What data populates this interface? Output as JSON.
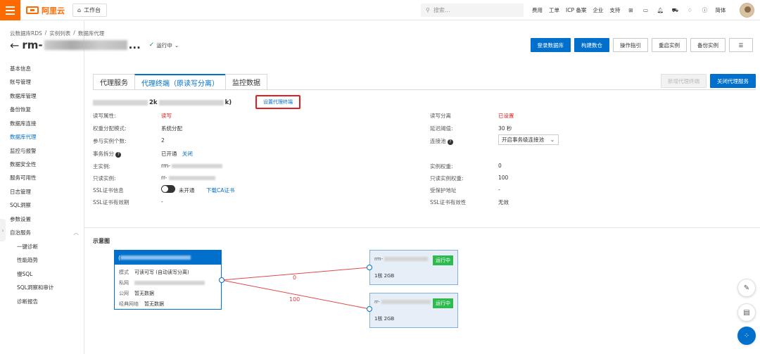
{
  "topbar": {
    "logo_text": "阿里云",
    "workbench": "工作台",
    "search_placeholder": "搜索...",
    "links": [
      "费用",
      "工单",
      "ICP 备案",
      "企业",
      "支持"
    ],
    "lang": "简体"
  },
  "sidebar": {
    "items": [
      "基本信息",
      "账号管理",
      "数据库管理",
      "备份恢复",
      "数据库连接",
      "数据库代理",
      "监控与报警",
      "数据安全性",
      "服务可用性",
      "日志管理",
      "SQL洞察",
      "参数设置",
      "自治服务"
    ],
    "active_index": 5,
    "sub_items": [
      "一键诊断",
      "性能趋势",
      "慢SQL",
      "SQL洞察和审计",
      "诊断报告"
    ]
  },
  "header": {
    "breadcrumb": [
      "云数据库RDS",
      "/",
      "实例列表",
      "/",
      "数据库代理"
    ],
    "title_prefix": "rm-",
    "title_suffix": "...",
    "status": "运行中",
    "buttons": [
      "登录数据库",
      "构建数仓",
      "操作指引",
      "重启实例",
      "备份实例"
    ]
  },
  "tabs": {
    "items": [
      "代理服务",
      "代理终端（原读写分离）",
      "监控数据"
    ],
    "active_index": 1,
    "new_endpoint": "新增代理终端",
    "close_proxy": "关闭代理服务"
  },
  "endpoint": {
    "name_fragment_1": "2k",
    "name_fragment_2": "k)",
    "set_endpoint": "设置代理终端"
  },
  "left_info": [
    {
      "label": "读写属性:",
      "value": "读写"
    },
    {
      "label": "权重分配模式:",
      "value": "系统分配"
    },
    {
      "label": "参与实例个数:",
      "value": "2"
    },
    {
      "label": "事务拆分",
      "value": "已开通",
      "link": "关闭"
    },
    {
      "label": "主实例:",
      "value": "rm-"
    },
    {
      "label": "只读实例:",
      "value": "rr-"
    },
    {
      "label": "SSL证书信息",
      "value": "未开通",
      "link": "下载CA证书"
    },
    {
      "label": "SSL证书有效期",
      "value": "-"
    }
  ],
  "right_info": [
    {
      "label": "读写分离",
      "value": "已设置"
    },
    {
      "label": "延迟阈值:",
      "value": "30 秒"
    },
    {
      "label": "连接池",
      "value": "开启事务级连接池"
    },
    {
      "label": "实例权重:",
      "value": "0"
    },
    {
      "label": "只读实例权重:",
      "value": "100"
    },
    {
      "label": "受保护地址",
      "value": "-"
    },
    {
      "label": "SSL证书有效性",
      "value": "无效"
    }
  ],
  "diagram": {
    "title": "示意图",
    "proxy": {
      "head": "(",
      "rows": [
        {
          "k": "模式",
          "v": "可读可写 (自动读写分离)"
        },
        {
          "k": "私网",
          "v": ""
        },
        {
          "k": "公网",
          "v": "暂无数据"
        },
        {
          "k": "经典网络",
          "v": "暂无数据"
        }
      ]
    },
    "instances": [
      {
        "name": "rm-",
        "status": "运行中",
        "spec": "1核 2GB",
        "weight": "0"
      },
      {
        "name": "rr-",
        "status": "运行中",
        "spec": "1核 2GB",
        "weight": "100"
      }
    ]
  },
  "colors": {
    "accent": "#0070cc",
    "brand": "#ff6a00",
    "running": "#2dba4e",
    "warn": "#e02020"
  }
}
